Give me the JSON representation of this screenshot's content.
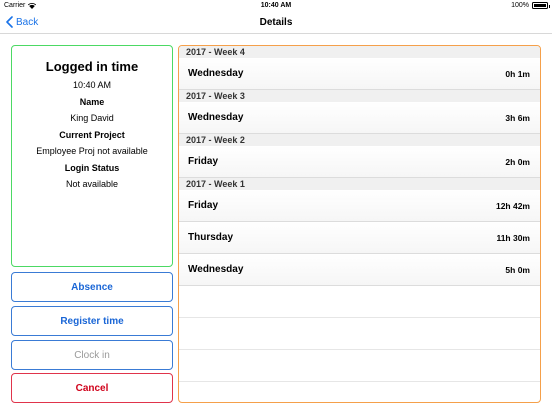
{
  "status_bar": {
    "carrier": "Carrier",
    "time": "10:40 AM",
    "battery_percent": "100%",
    "battery_level": 1.0
  },
  "nav": {
    "back_label": "Back",
    "title": "Details"
  },
  "login": {
    "heading": "Logged in time",
    "time": "10:40 AM",
    "name_label": "Name",
    "name_value": "King David",
    "project_label": "Current Project",
    "project_value": "Employee Proj not available",
    "status_label": "Login Status",
    "status_value": "Not available"
  },
  "actions": {
    "absence": "Absence",
    "register_time": "Register time",
    "clock_in": "Clock in",
    "cancel": "Cancel"
  },
  "weeks": [
    {
      "header": "2017 - Week 4",
      "rows": [
        {
          "day": "Wednesday",
          "duration": "0h 1m"
        }
      ]
    },
    {
      "header": "2017 - Week 3",
      "rows": [
        {
          "day": "Wednesday",
          "duration": "3h 6m"
        }
      ]
    },
    {
      "header": "2017 - Week 2",
      "rows": [
        {
          "day": "Friday",
          "duration": "2h 0m"
        }
      ]
    },
    {
      "header": "2017 - Week 1",
      "rows": [
        {
          "day": "Friday",
          "duration": "12h 42m"
        },
        {
          "day": "Thursday",
          "duration": "11h 30m"
        },
        {
          "day": "Wednesday",
          "duration": "5h 0m"
        }
      ]
    }
  ]
}
